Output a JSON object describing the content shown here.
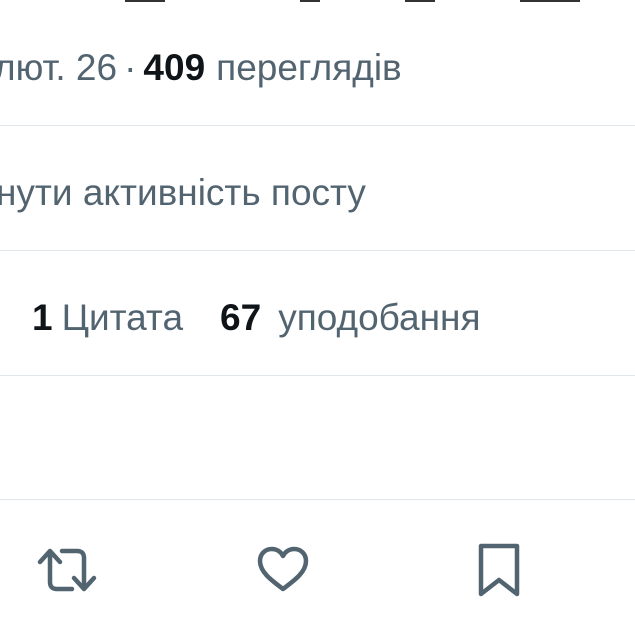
{
  "tweet_meta": {
    "date_fragment": "лют. 26",
    "separator": "·",
    "views_count": "409",
    "views_label": "переглядів"
  },
  "activity": {
    "label": "нути активність посту"
  },
  "stats": {
    "quote_count": "1",
    "quote_label": "Цитата",
    "likes_count": "67",
    "likes_label": "уподобання"
  },
  "actions": [
    {
      "icon": "retweet-icon"
    },
    {
      "icon": "heart-icon"
    },
    {
      "icon": "bookmark-icon"
    }
  ],
  "colors": {
    "text_muted": "#536471",
    "text_strong": "#0f1419",
    "divider": "#e1e6ea",
    "background": "#ffffff"
  }
}
